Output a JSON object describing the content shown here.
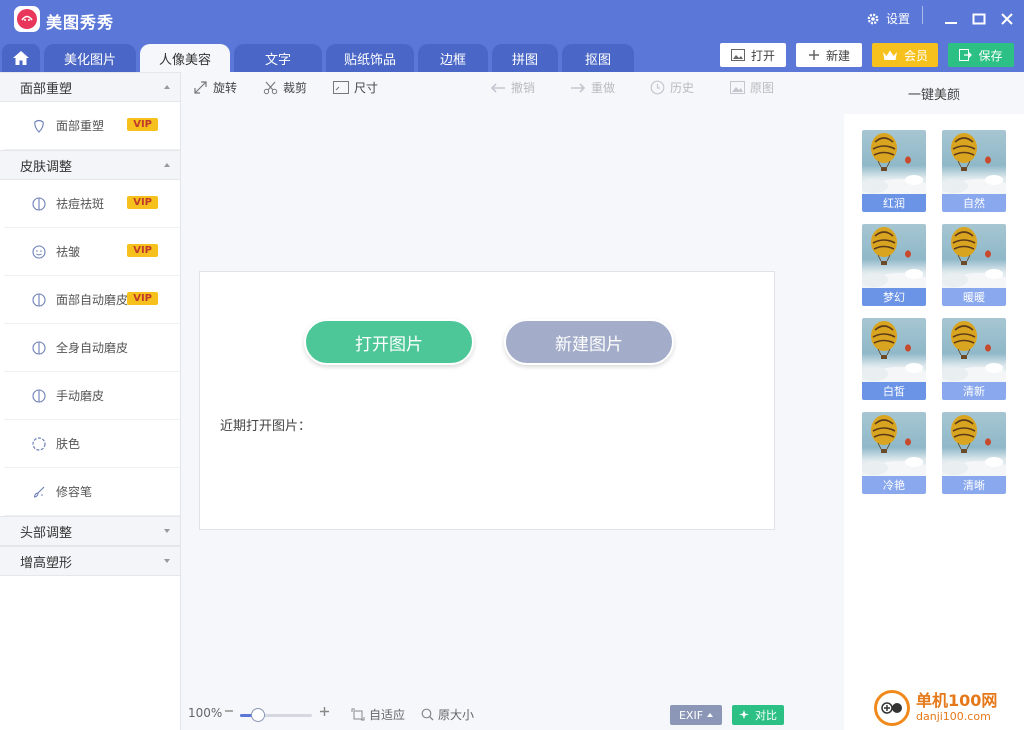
{
  "app": {
    "title": "美图秀秀",
    "settings_label": "设置"
  },
  "tabs": [
    {
      "label": "美化图片"
    },
    {
      "label": "人像美容",
      "active": true
    },
    {
      "label": "文字"
    },
    {
      "label": "贴纸饰品"
    },
    {
      "label": "边框"
    },
    {
      "label": "拼图"
    },
    {
      "label": "抠图"
    }
  ],
  "top_buttons": {
    "open": "打开",
    "new": "新建",
    "member": "会员",
    "save": "保存"
  },
  "left_panel": {
    "sections": [
      {
        "label": "面部重塑",
        "expanded": true,
        "items": [
          {
            "label": "面部重塑",
            "vip": "VIP",
            "icon": "face-outline-icon"
          }
        ]
      },
      {
        "label": "皮肤调整",
        "expanded": true,
        "items": [
          {
            "label": "祛痘祛斑",
            "vip": "VIP",
            "icon": "half-circle-icon"
          },
          {
            "label": "祛皱",
            "vip": "VIP",
            "icon": "smiley-icon"
          },
          {
            "label": "面部自动磨皮",
            "vip": "VIP",
            "icon": "half-circle-icon"
          },
          {
            "label": "全身自动磨皮",
            "icon": "half-circle-icon"
          },
          {
            "label": "手动磨皮",
            "icon": "half-circle-icon"
          },
          {
            "label": "肤色",
            "icon": "dashed-circle-icon"
          },
          {
            "label": "修容笔",
            "icon": "brush-icon"
          }
        ]
      },
      {
        "label": "头部调整",
        "expanded": false
      },
      {
        "label": "增高塑形",
        "expanded": false
      }
    ]
  },
  "toolbar": {
    "rotate": "旋转",
    "crop": "裁剪",
    "size": "尺寸",
    "undo": "撤销",
    "redo": "重做",
    "history": "历史",
    "original": "原图"
  },
  "canvas": {
    "open_image": "打开图片",
    "new_image": "新建图片",
    "recent_label": "近期打开图片："
  },
  "right_panel": {
    "title": "一键美颜",
    "presets": [
      {
        "label": "红润"
      },
      {
        "label": "自然"
      },
      {
        "label": "梦幻"
      },
      {
        "label": "暖暖"
      },
      {
        "label": "白皙"
      },
      {
        "label": "清新"
      },
      {
        "label": "冷艳"
      },
      {
        "label": "清晰"
      }
    ]
  },
  "statusbar": {
    "zoom": "100%",
    "zoom_fraction": 0.25,
    "fit": "自适应",
    "original_size": "原大小",
    "exif": "EXIF",
    "compare": "对比"
  },
  "watermark": {
    "site_name": "单机100网",
    "site_url": "danji100.com"
  },
  "colors": {
    "brand_blue": "#5b77d8",
    "open_green": "#4dc797",
    "new_gray": "#a3acc8",
    "vip_gold": "#f6c11c",
    "save_green": "#2cc084"
  }
}
